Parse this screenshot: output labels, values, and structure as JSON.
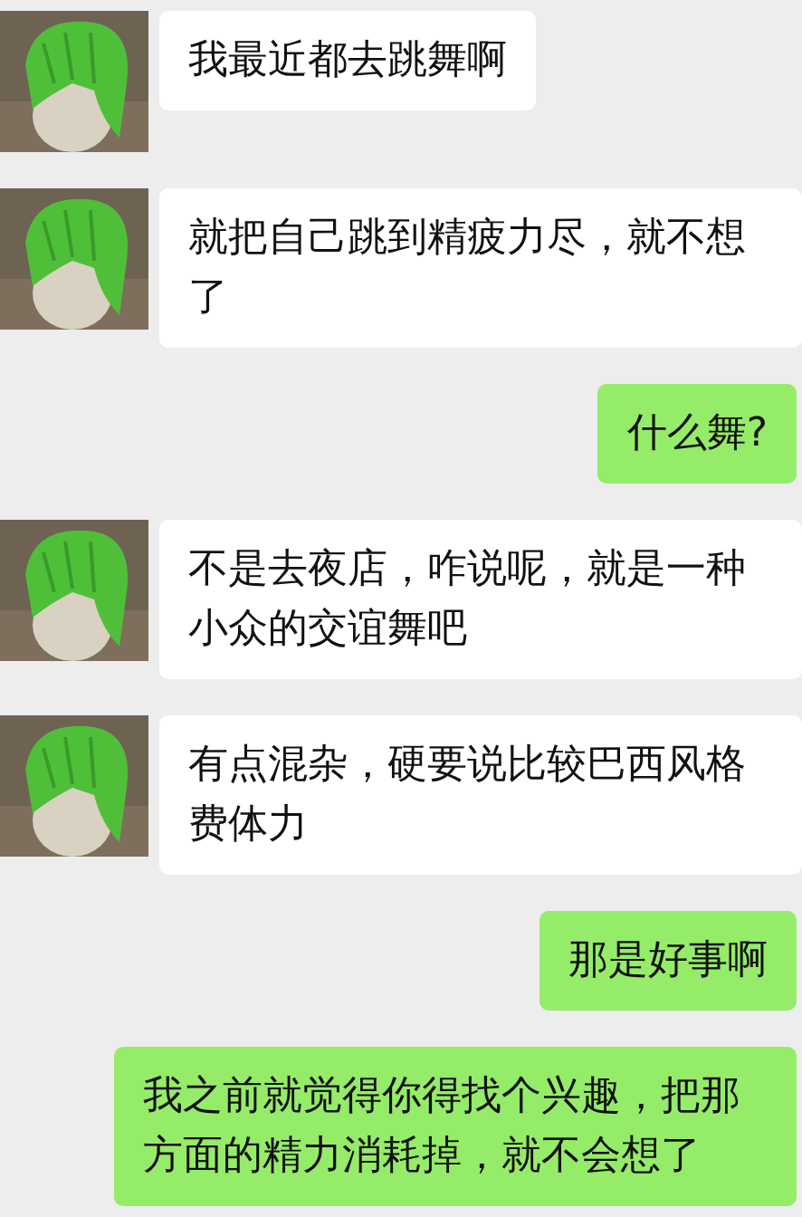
{
  "messages": [
    {
      "kind": "incoming",
      "text": "我最近都去跳舞啊"
    },
    {
      "kind": "incoming",
      "text": "就把自己跳到精疲力尽，就不想了"
    },
    {
      "kind": "outgoing",
      "text": "什么舞?"
    },
    {
      "kind": "incoming",
      "text": "不是去夜店，咋说呢，就是一种小众的交谊舞吧"
    },
    {
      "kind": "incoming",
      "text": "有点混杂，硬要说比较巴西风格费体力"
    },
    {
      "kind": "outgoing",
      "text": "那是好事啊"
    },
    {
      "kind": "outgoing",
      "text": "我之前就觉得你得找个兴趣，把那方面的精力消耗掉，就不会想了"
    }
  ]
}
